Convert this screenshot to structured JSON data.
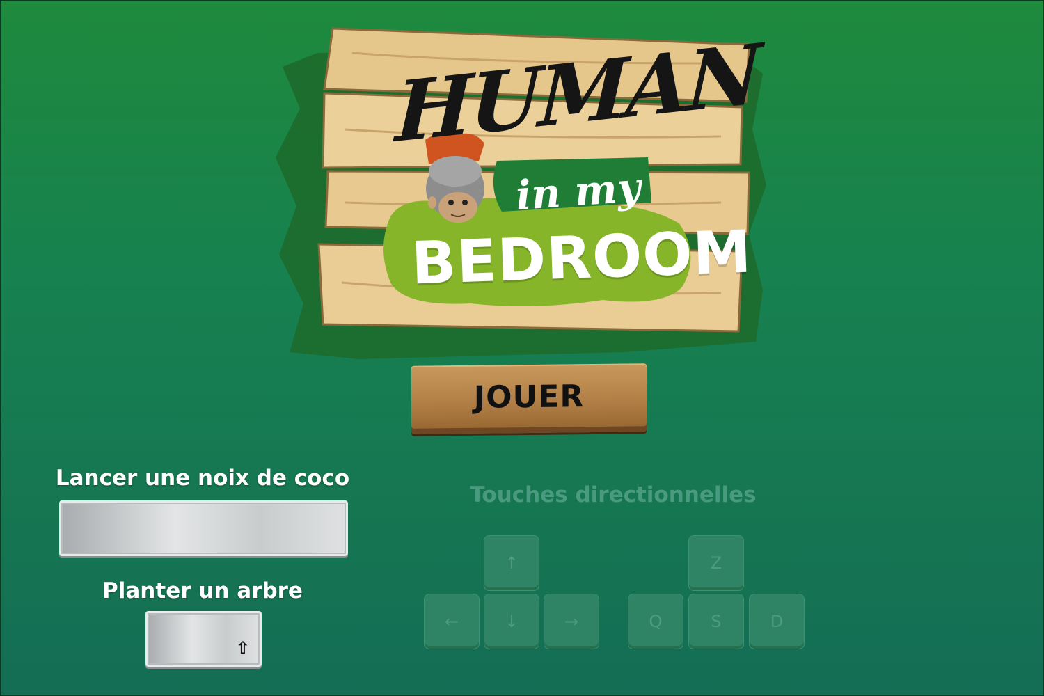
{
  "logo": {
    "line1": "HUMAN",
    "line2": "in my",
    "line3": "BEDROOM"
  },
  "play_button": {
    "label": "JOUER"
  },
  "controls": {
    "coconut_label": "Lancer une noix de coco",
    "tree_label": "Planter un arbre",
    "shift_glyph": "⇧"
  },
  "directional": {
    "title": "Touches directionnelles",
    "arrows": {
      "up": "↑",
      "left": "←",
      "down": "↓",
      "right": "→"
    },
    "letters": {
      "up": "Z",
      "left": "Q",
      "down": "S",
      "right": "D"
    }
  },
  "colors": {
    "background_top": "#1e8a3c",
    "background_bottom": "#146d54",
    "wood": "#e8c98e",
    "leaf_green": "#86b52a",
    "banner_green": "#1f7d35"
  },
  "icons": [
    "monkey-mascot",
    "shift-arrow-icon",
    "arrow-up-icon",
    "arrow-left-icon",
    "arrow-down-icon",
    "arrow-right-icon"
  ]
}
